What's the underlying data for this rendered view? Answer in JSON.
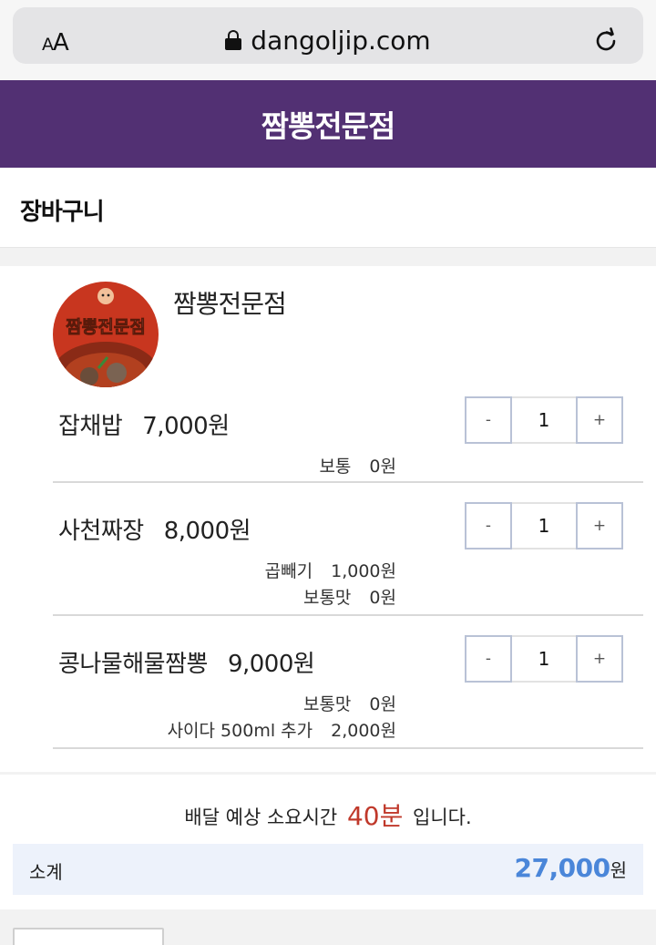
{
  "browser": {
    "text_size_label": "AA",
    "url": "dangoljip.com"
  },
  "header": {
    "title": "짬뽕전문점"
  },
  "cart": {
    "title": "장바구니"
  },
  "store": {
    "name": "짬뽕전문점",
    "logo_text": "짬뽕전문점"
  },
  "items": [
    {
      "name": "잡채밥",
      "price": "7,000원",
      "quantity": "1",
      "options": [
        {
          "name": "보통",
          "price": "0원"
        }
      ]
    },
    {
      "name": "사천짜장",
      "price": "8,000원",
      "quantity": "1",
      "options": [
        {
          "name": "곱빼기",
          "price": "1,000원"
        },
        {
          "name": "보통맛",
          "price": "0원"
        }
      ]
    },
    {
      "name": "콩나물해물짬뽕",
      "price": "9,000원",
      "quantity": "1",
      "options": [
        {
          "name": "보통맛",
          "price": "0원"
        },
        {
          "name": "사이다 500ml 추가",
          "price": "2,000원"
        }
      ]
    }
  ],
  "stepper": {
    "minus": "-",
    "plus": "+"
  },
  "delivery": {
    "prefix": "배달 예상 소요시간",
    "minutes": "40분",
    "suffix": "입니다."
  },
  "subtotal": {
    "label": "소계",
    "amount": "27,000",
    "unit": "원"
  },
  "colors": {
    "header_bg": "#523073",
    "accent_blue": "#4a86d9",
    "accent_red": "#c0392b",
    "subtotal_bg": "#edf2fb"
  }
}
